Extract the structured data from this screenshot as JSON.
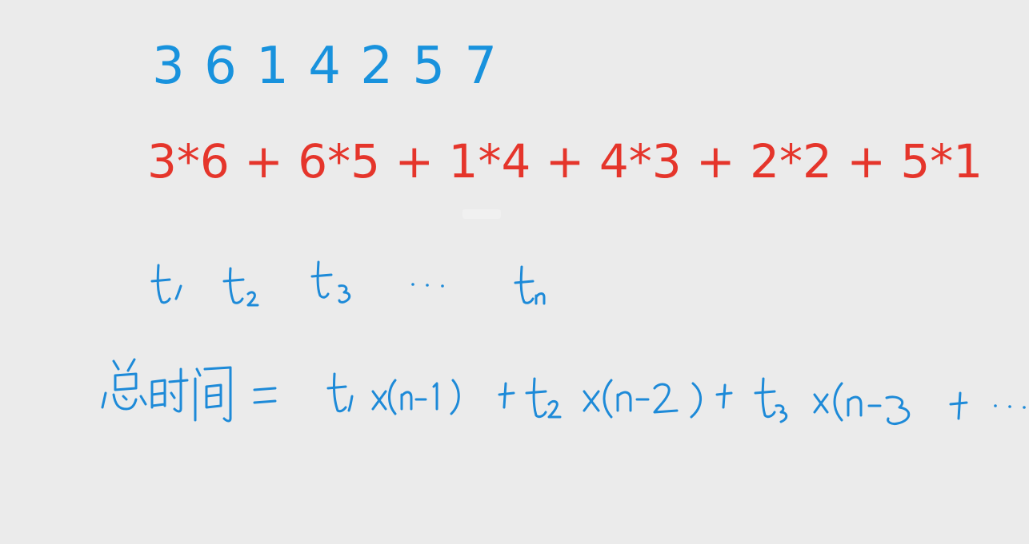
{
  "typed": {
    "sequence": "3 6 1 4 2 5 7",
    "expression": "3*6 + 6*5 + 1*4 + 4*3 + 2*2 + 5*1"
  },
  "handwritten": {
    "time_labels": [
      "t₁",
      "t₂",
      "t₃",
      "…",
      "tₙ"
    ],
    "formula": "总时间 = t₁ × (n-1) + t₂ × (n-2) + t₃ × (n-3) + …"
  },
  "colors": {
    "background": "#ebebeb",
    "sequence": "#1892dd",
    "expression": "#e5352b",
    "ink": "#1d8ad8"
  }
}
